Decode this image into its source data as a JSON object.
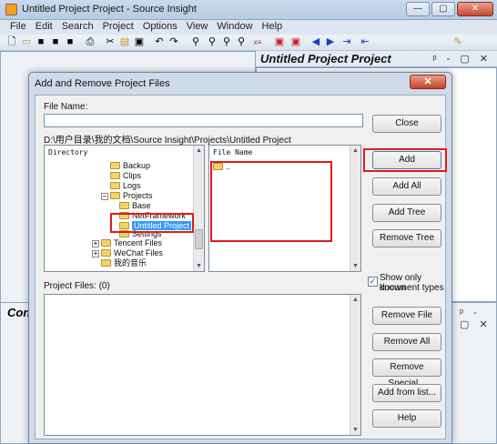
{
  "app": {
    "title": "Untitled Project Project - Source Insight",
    "window_buttons": [
      "—",
      "▢",
      "✕"
    ]
  },
  "menu": [
    "File",
    "Edit",
    "Search",
    "Project",
    "Options",
    "View",
    "Window",
    "Help"
  ],
  "toolbar_icons": [
    "new-file-icon",
    "open-folder-icon",
    "save-icon",
    "save-all-icon",
    "close-icon",
    "print-icon",
    "cut-icon",
    "copy-icon",
    "paste-icon",
    "undo-icon",
    "redo-icon",
    "binoculars-icon",
    "find-prev-icon",
    "find-next-icon",
    "find-files-icon",
    "replace-icon",
    "bookmark-icon",
    "bookmark-list-icon",
    "back-icon",
    "forward-icon",
    "jump-icon",
    "jump-back-icon",
    "pen-icon"
  ],
  "project_pane": {
    "title": "Untitled Project Project",
    "controls": "ᵖ - ▢ ✕"
  },
  "context_pane": {
    "title": "Con"
  },
  "dialog": {
    "title": "Add and Remove Project Files",
    "close_glyph": "✕",
    "file_name_label": "File Name:",
    "file_name_value": "",
    "path": "D:\\用户目录\\我的文档\\Source Insight\\Projects\\Untitled Project",
    "directory_header": "Directory",
    "file_name_header": "File Name",
    "directory_tree": [
      {
        "label": "Backup"
      },
      {
        "label": "Clips"
      },
      {
        "label": "Logs"
      },
      {
        "label": "Projects",
        "expander": "−"
      },
      {
        "label": "Base"
      },
      {
        "label": "NetFramework"
      },
      {
        "label": "Untitled Project",
        "selected": true
      },
      {
        "label": "Settings"
      },
      {
        "label": "Tencent Files",
        "expander": "+"
      },
      {
        "label": "WeChat Files",
        "expander": "+"
      },
      {
        "label": "我的音乐"
      }
    ],
    "file_list": [
      {
        "label": ".."
      }
    ],
    "project_files_label": "Project Files: (0)",
    "show_known_checkbox": {
      "checked": true,
      "label_line1": "Show only known",
      "label_line2": "document types"
    },
    "buttons": {
      "close": "Close",
      "add": "Add",
      "add_all": "Add All",
      "add_tree": "Add Tree",
      "remove_tree": "Remove Tree",
      "remove_file": "Remove File",
      "remove_all": "Remove All",
      "remove_special": "Remove Special...",
      "add_from_list": "Add from list...",
      "help": "Help"
    }
  },
  "colors": {
    "highlight": "#e21b1b",
    "selection": "#3399ff",
    "folder": "#f2d36c"
  }
}
